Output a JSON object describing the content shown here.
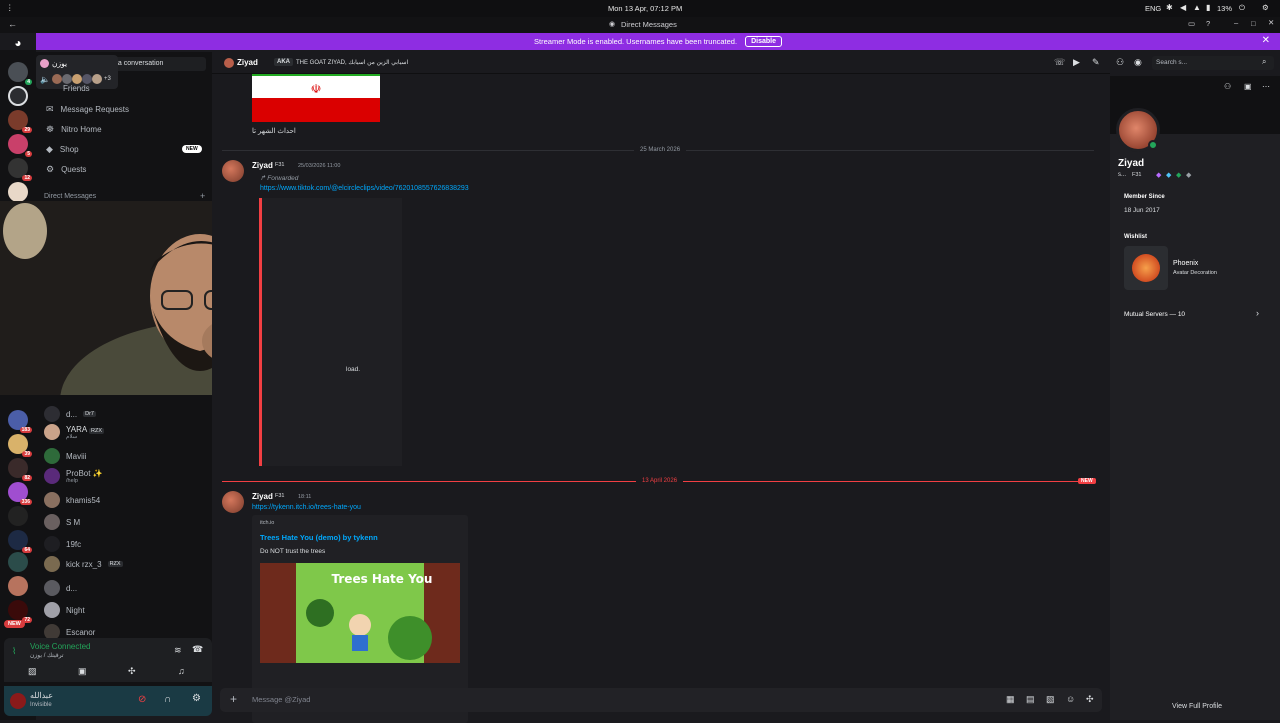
{
  "os": {
    "datetime": "Mon 13 Apr, 07:12 PM",
    "lang": "ENG",
    "battery": "13%"
  },
  "window": {
    "title": "Direct Messages"
  },
  "banner": {
    "text": "Streamer Mode is enabled. Usernames have been truncated.",
    "button": "Disable"
  },
  "rail": {
    "badges": [
      "4",
      "29",
      "5",
      "12",
      "183",
      "39",
      "82",
      "336",
      "64",
      "72"
    ],
    "new_label": "NEW"
  },
  "dm_sidebar": {
    "search_placeholder": "t a conversation",
    "popup_name": "يوزن",
    "popup_more": "+3",
    "nav": [
      {
        "label": "Friends"
      },
      {
        "label": "Message Requests"
      },
      {
        "label": "Nitro Home"
      },
      {
        "label": "Shop",
        "badge": "NEW"
      },
      {
        "label": "Quests"
      }
    ],
    "section": "Direct Messages",
    "dms": [
      {
        "name": "d...",
        "tag": "Dr7"
      },
      {
        "name": "YARA",
        "tag": "RZX",
        "sub": "سلام"
      },
      {
        "name": "Maviii"
      },
      {
        "name": "ProBot ✨",
        "sub": "/help"
      },
      {
        "name": "khamis54"
      },
      {
        "name": "S M"
      },
      {
        "name": "19fc"
      },
      {
        "name": "kick rzx_3",
        "tag": "RZX"
      },
      {
        "name": "d..."
      },
      {
        "name": "Night"
      },
      {
        "name": "Escanor"
      }
    ],
    "voice": {
      "title": "Voice Connected",
      "channel": "ترقيتك / يوزن"
    },
    "user": {
      "name": "عبدالله",
      "status": "Invisible"
    }
  },
  "chat": {
    "header": {
      "name": "Ziyad",
      "aka_label": "AKA",
      "aka": "THE GOAT ZIYAD, اسيابي الزين من اسيابك"
    },
    "search_placeholder": "Search s...",
    "top_caption": "احداث الشهر تا",
    "dividers": [
      "25 March 2026",
      "13 April 2026"
    ],
    "new_badge": "NEW",
    "messages": [
      {
        "author": "Ziyad",
        "tag": "F31",
        "time": "25/03/2026 11:00",
        "forwarded": "Forwarded",
        "link": "https://www.tiktok.com/@elcircleclips/video/7620108557626838293",
        "partial": "load."
      },
      {
        "author": "Ziyad",
        "tag": "F31",
        "time": "18:11",
        "link": "https://tykenn.itch.io/trees-hate-you",
        "embed": {
          "provider": "itch.io",
          "title": "Trees Hate You (demo) by tykenn",
          "desc": "Do NOT trust the trees",
          "image_title": "Trees Hate You"
        }
      }
    ],
    "input_placeholder": "Message @Ziyad"
  },
  "profile": {
    "name": "Ziyad",
    "short": "s...",
    "tag": "F31",
    "member_since_label": "Member Since",
    "member_since": "18 Jun 2017",
    "wishlist_label": "Wishlist",
    "wish_item": "Phoenix",
    "wish_sub": "Avatar Decoration",
    "mutual": "Mutual Servers — 10",
    "view_full": "View Full Profile"
  },
  "colors": {
    "blurple": "#8e2de2",
    "online": "#23a55a",
    "mention": "#f23f43",
    "link": "#00a8fc"
  }
}
